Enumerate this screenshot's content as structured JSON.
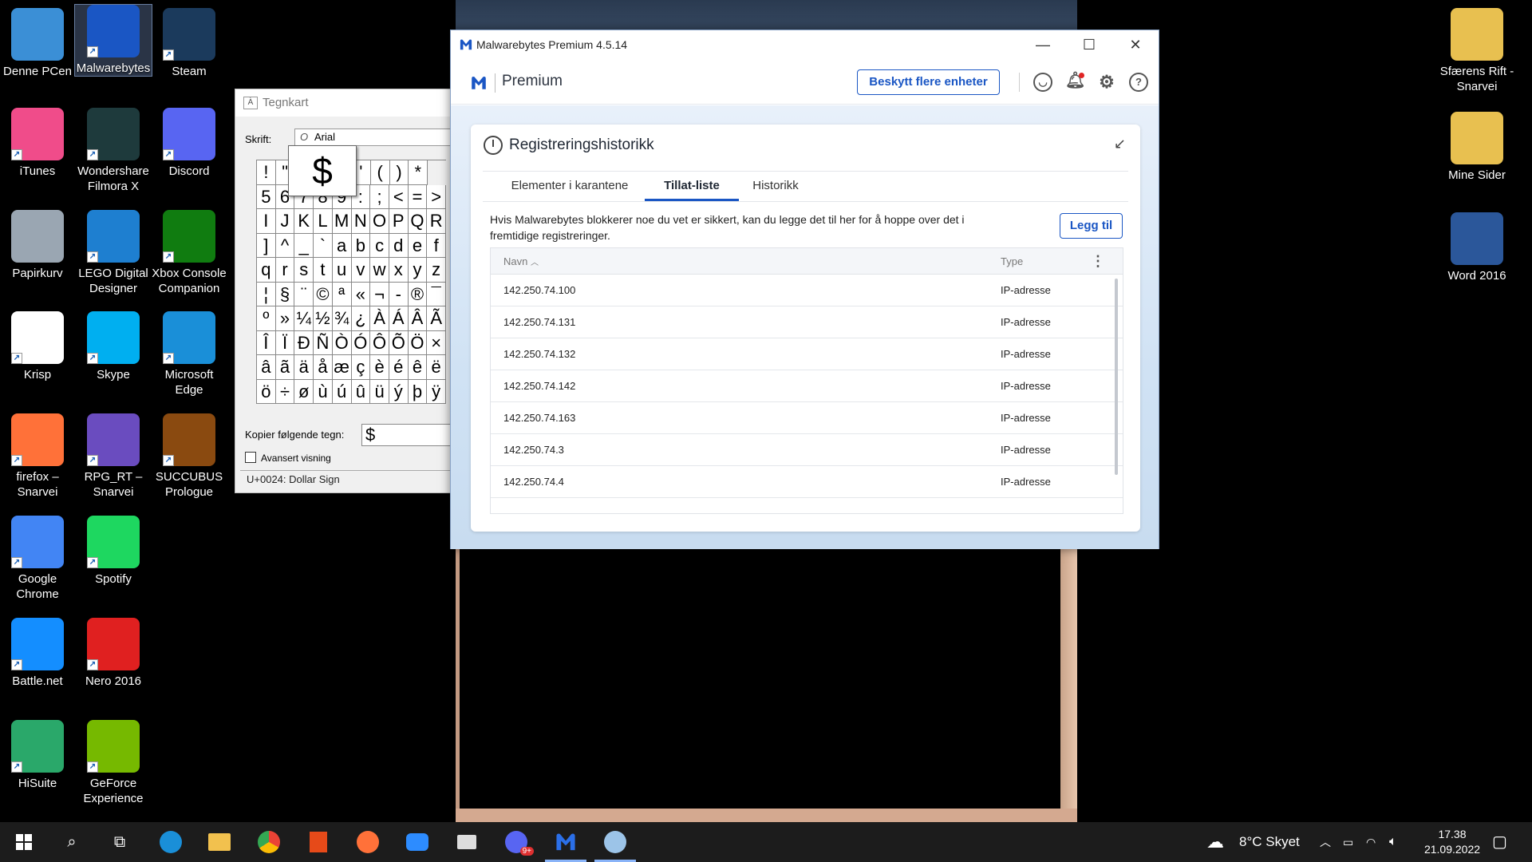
{
  "desktop_icons": [
    {
      "label": "Denne PCen",
      "icon": "computer-icon",
      "color": "#3b8fd6"
    },
    {
      "label": "Malwarebytes",
      "icon": "malwarebytes-icon",
      "color": "#1a56c4"
    },
    {
      "label": "Steam",
      "icon": "steam-icon",
      "color": "#1b3a5c"
    },
    {
      "label": "iTunes",
      "icon": "itunes-icon",
      "color": "#f04c8a"
    },
    {
      "label": "Wondershare Filmora X",
      "icon": "filmora-icon",
      "color": "#1e3a3c"
    },
    {
      "label": "Discord",
      "icon": "discord-icon",
      "color": "#5865f2"
    },
    {
      "label": "Papirkurv",
      "icon": "recycle-bin-icon",
      "color": "#9aa6b2"
    },
    {
      "label": "LEGO Digital Designer",
      "icon": "lego-icon",
      "color": "#1e7fd0"
    },
    {
      "label": "Xbox Console Companion",
      "icon": "xbox-icon",
      "color": "#107c10"
    },
    {
      "label": "Krisp",
      "icon": "krisp-icon",
      "color": "#ffffff"
    },
    {
      "label": "Skype",
      "icon": "skype-icon",
      "color": "#00aff0"
    },
    {
      "label": "Microsoft Edge",
      "icon": "edge-icon",
      "color": "#1a8fd8"
    },
    {
      "label": "firefox – Snarvei",
      "icon": "firefox-icon",
      "color": "#ff7139"
    },
    {
      "label": "RPG_RT – Snarvei",
      "icon": "rpg-icon",
      "color": "#6a4cbf"
    },
    {
      "label": "SUCCUBUS Prologue",
      "icon": "succubus-icon",
      "color": "#8a4a10"
    },
    {
      "label": "Google Chrome",
      "icon": "chrome-icon",
      "color": "#4285f4"
    },
    {
      "label": "Spotify",
      "icon": "spotify-icon",
      "color": "#1ed760"
    },
    {
      "label": "Battle.net",
      "icon": "battlenet-icon",
      "color": "#148eff"
    },
    {
      "label": "Nero 2016",
      "icon": "nero-icon",
      "color": "#e02020"
    },
    {
      "label": "HiSuite",
      "icon": "hisuite-icon",
      "color": "#2aa86a"
    },
    {
      "label": "GeForce Experience",
      "icon": "geforce-icon",
      "color": "#76b900"
    },
    {
      "label": "Sfærens Rift - Snarvei",
      "icon": "folder-icon",
      "color": "#e8c050"
    },
    {
      "label": "Mine Sider",
      "icon": "folder-icon",
      "color": "#e8c050"
    },
    {
      "label": "Word 2016",
      "icon": "word-icon",
      "color": "#2b579a"
    }
  ],
  "charmap": {
    "title": "Tegnkart",
    "font_label": "Skrift:",
    "font_value": "Arial",
    "zoom_char": "$",
    "grid": [
      [
        "!",
        "\"",
        "$",
        "%",
        "&",
        "'",
        "(",
        ")",
        "*"
      ],
      [
        "5",
        "6",
        "7",
        "8",
        "9",
        ":",
        ";",
        "<",
        "=",
        ">"
      ],
      [
        "I",
        "J",
        "K",
        "L",
        "M",
        "N",
        "O",
        "P",
        "Q",
        "R"
      ],
      [
        "]",
        "^",
        "_",
        "`",
        "a",
        "b",
        "c",
        "d",
        "e",
        "f"
      ],
      [
        "q",
        "r",
        "s",
        "t",
        "u",
        "v",
        "w",
        "x",
        "y",
        "z"
      ],
      [
        "¦",
        "§",
        "¨",
        "©",
        "ª",
        "«",
        "¬",
        "-",
        "®",
        "¯"
      ],
      [
        "º",
        "»",
        "¼",
        "½",
        "¾",
        "¿",
        "À",
        "Á",
        "Â",
        "Ã"
      ],
      [
        "Î",
        "Ï",
        "Ð",
        "Ñ",
        "Ò",
        "Ó",
        "Ô",
        "Õ",
        "Ö",
        "×"
      ],
      [
        "â",
        "ã",
        "ä",
        "å",
        "æ",
        "ç",
        "è",
        "é",
        "ê",
        "ë"
      ],
      [
        "ö",
        "÷",
        "ø",
        "ù",
        "ú",
        "û",
        "ü",
        "ý",
        "þ",
        "ÿ"
      ]
    ],
    "copy_label": "Kopier følgende tegn:",
    "copy_value": "$",
    "advanced_label": "Avansert visning",
    "status": "U+0024: Dollar Sign"
  },
  "malwarebytes": {
    "window_title": "Malwarebytes Premium  4.5.14",
    "brand": "Premium",
    "protect_button": "Beskytt flere enheter",
    "panel_title": "Registreringshistorikk",
    "tabs": [
      "Elementer i karantene",
      "Tillat-liste",
      "Historikk"
    ],
    "active_tab": "Tillat-liste",
    "description": "Hvis Malwarebytes blokkerer noe du vet er sikkert, kan du legge det til her for å hoppe over det i fremtidige registreringer.",
    "add_button": "Legg til",
    "columns": {
      "name": "Navn",
      "type": "Type"
    },
    "rows": [
      {
        "name": "142.250.74.100",
        "type": "IP-adresse"
      },
      {
        "name": "142.250.74.131",
        "type": "IP-adresse"
      },
      {
        "name": "142.250.74.132",
        "type": "IP-adresse"
      },
      {
        "name": "142.250.74.142",
        "type": "IP-adresse"
      },
      {
        "name": "142.250.74.163",
        "type": "IP-adresse"
      },
      {
        "name": "142.250.74.3",
        "type": "IP-adresse"
      },
      {
        "name": "142.250.74.4",
        "type": "IP-adresse"
      }
    ]
  },
  "taskbar": {
    "weather": "8°C  Skyet",
    "time": "17.38",
    "date": "21.09.2022",
    "badge": "9+"
  }
}
